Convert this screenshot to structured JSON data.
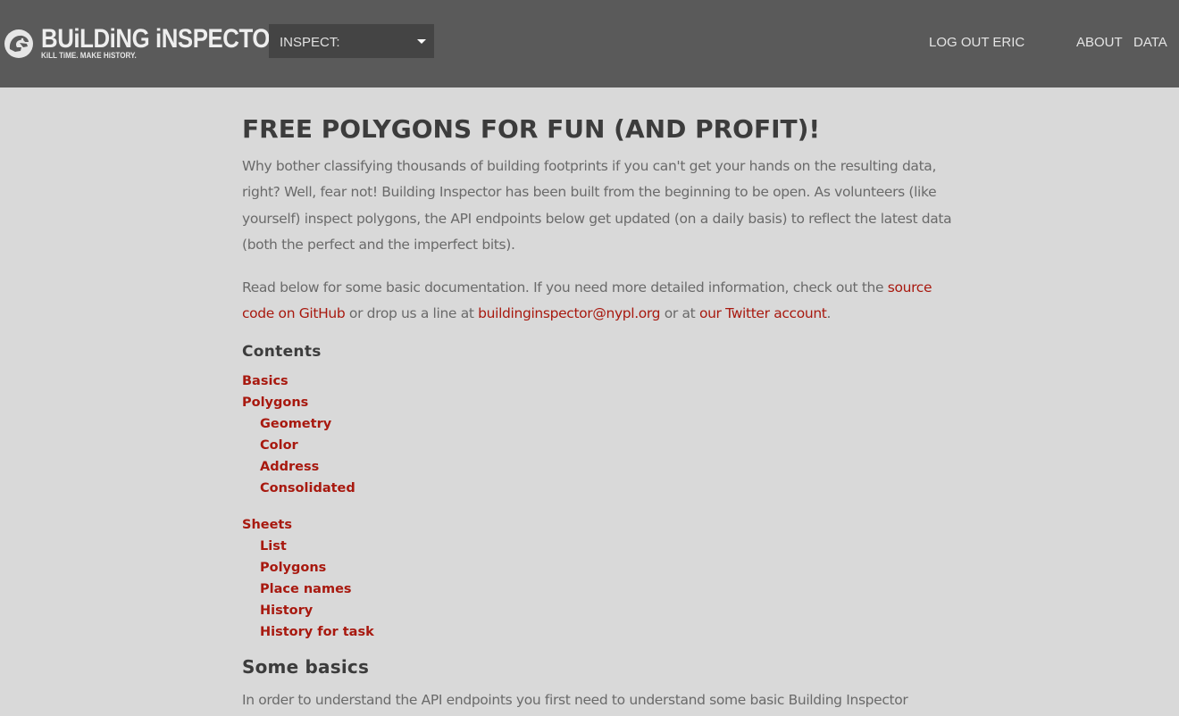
{
  "header": {
    "logo": {
      "title": "BUiLDiNG iNSPECTOR",
      "tagline": "KiLL TiME. MAKE HiSTORY."
    },
    "inspect_select": {
      "label": "INSPECT:"
    },
    "nav": {
      "logout": "LOG OUT ERIC",
      "about": "ABOUT",
      "data": "DATA"
    }
  },
  "main": {
    "title": "FREE POLYGONS FOR FUN (AND PROFIT)!",
    "intro": "Why bother classifying thousands of building footprints if you can't get your hands on the resulting data, right? Well, fear not! Building Inspector has been built from the beginning to be open. As volunteers (like yourself) inspect polygons, the API endpoints below get updated (on a daily basis) to reflect the latest data (both the perfect and the imperfect bits).",
    "doc_text_1": "Read below for some basic documentation. If you need more detailed information, check out the ",
    "github_link": "source code on GitHub",
    "doc_text_2": " or drop us a line at ",
    "email_link": "buildinginspector@nypl.org",
    "doc_text_3": " or at ",
    "twitter_link": "our Twitter account",
    "doc_text_4": ".",
    "contents_title": "Contents",
    "toc": {
      "basics": "Basics",
      "polygons": {
        "label": "Polygons",
        "children": [
          "Geometry",
          "Color",
          "Address",
          "Consolidated"
        ]
      },
      "sheets": {
        "label": "Sheets",
        "children": [
          "List",
          "Polygons",
          "Place names",
          "History",
          "History for task"
        ]
      }
    },
    "section_title": "Some basics",
    "section_intro": "In order to understand the API endpoints you first need to understand some basic Building Inspector"
  },
  "colors": {
    "header_bg": "#5a5a5a",
    "page_bg": "#d9d9d9",
    "link": "#a8190f",
    "heading": "#3c3c3c"
  }
}
